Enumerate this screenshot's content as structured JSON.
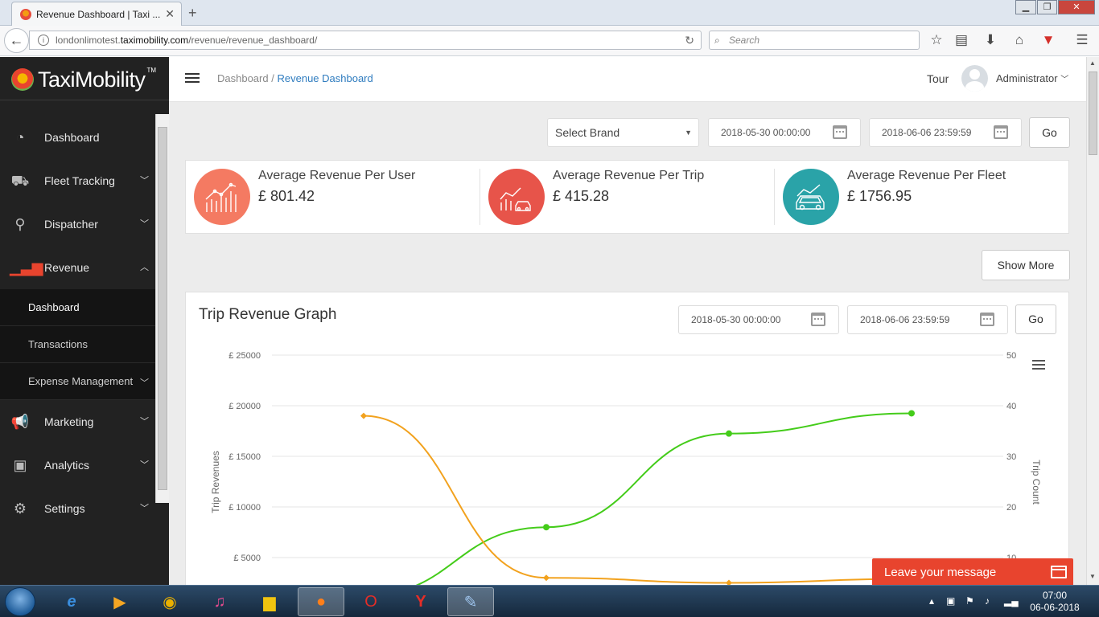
{
  "browser": {
    "tab_title": "Revenue Dashboard | Taxi ...",
    "tab_close": "✕",
    "new_tab": "+",
    "url_path_prefix": "londonlimotest.",
    "url_domain": "taximobility.com",
    "url_path": "/revenue/revenue_dashboard/",
    "search_placeholder": "Search"
  },
  "sidebar": {
    "brand_name": "TaxiMobility",
    "brand_tm": "TM",
    "items": [
      {
        "label": "Dashboard",
        "icon": "speedometer-icon"
      },
      {
        "label": "Fleet Tracking",
        "icon": "car-icon"
      },
      {
        "label": "Dispatcher",
        "icon": "location-pin-icon"
      },
      {
        "label": "Revenue",
        "icon": "bar-chart-icon"
      },
      {
        "label": "Marketing",
        "icon": "megaphone-icon"
      },
      {
        "label": "Analytics",
        "icon": "report-icon"
      },
      {
        "label": "Settings",
        "icon": "gear-icon"
      }
    ],
    "revenue_submenu": [
      "Dashboard",
      "Transactions",
      "Expense Management"
    ]
  },
  "header": {
    "breadcrumb_root": "Dashboard",
    "breadcrumb_sep": "/",
    "breadcrumb_current": "Revenue Dashboard",
    "tour": "Tour",
    "user": "Administrator"
  },
  "filters": {
    "brand_select": "Select Brand",
    "from_date": "2018-05-30 00:00:00",
    "to_date": "2018-06-06 23:59:59",
    "go": "Go"
  },
  "stats": [
    {
      "label": "Average Revenue Per User",
      "value": "£ 801.42",
      "color": "#f47a62"
    },
    {
      "label": "Average Revenue Per Trip",
      "value": "£ 415.28",
      "color": "#e7544a"
    },
    {
      "label": "Average Revenue Per Fleet",
      "value": "£ 1756.95",
      "color": "#2aa3a8"
    }
  ],
  "show_more": "Show More",
  "graph": {
    "title": "Trip Revenue Graph",
    "from_date": "2018-05-30 00:00:00",
    "to_date": "2018-06-06 23:59:59",
    "go": "Go"
  },
  "chart_data": {
    "type": "line",
    "ylabel": "Trip Revenues",
    "y2label": "Trip Count",
    "ylim": [
      0,
      25000
    ],
    "y2lim": [
      0,
      50
    ],
    "y_ticks": [
      "£ 25000",
      "£ 20000",
      "£ 15000",
      "£ 10000",
      "£ 5000"
    ],
    "y2_ticks": [
      "50",
      "40",
      "30",
      "20",
      "10"
    ],
    "grid": true,
    "series": [
      {
        "axis": "right",
        "color": "#44cc1a",
        "marker": "circle",
        "values": [
          2.5,
          16,
          34.5,
          38.5
        ]
      },
      {
        "axis": "left",
        "color": "#f2a21e",
        "marker": "diamond",
        "values": [
          19000,
          3000,
          2500,
          2900
        ]
      }
    ]
  },
  "chat": {
    "label": "Leave your message"
  },
  "taskbar": {
    "apps": [
      "internet-explorer-icon",
      "media-player-icon",
      "chrome-icon",
      "itunes-icon",
      "file-explorer-icon",
      "firefox-icon",
      "opera-icon",
      "yandex-icon",
      "paint-icon"
    ],
    "time": "07:00",
    "date": "06-06-2018"
  }
}
